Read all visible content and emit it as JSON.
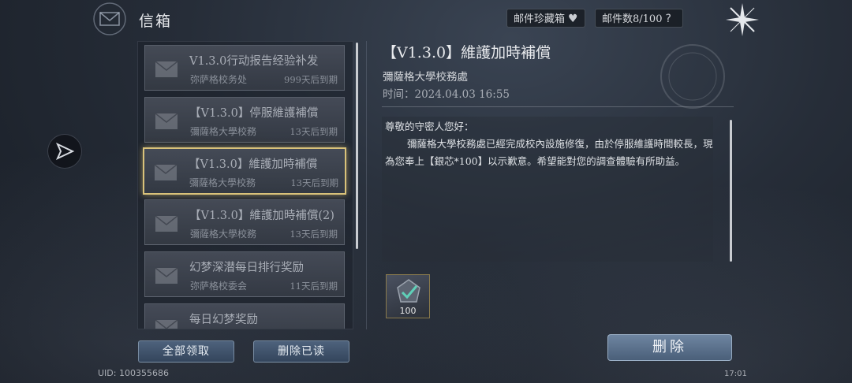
{
  "header": {
    "title": "信箱",
    "collection_label": "邮件珍藏箱",
    "mail_count_label": "邮件数8/100",
    "help_label": "?"
  },
  "mail_list": [
    {
      "subject": "V1.3.0行动报告经验补发",
      "sender": "弥萨格校务处",
      "expiry": "999天后到期"
    },
    {
      "subject": "【V1.3.0】停服維護補償",
      "sender": "彌薩格大學校務",
      "expiry": "13天后到期"
    },
    {
      "subject": "【V1.3.0】維護加時補償",
      "sender": "彌薩格大學校務",
      "expiry": "13天后到期",
      "selected": true
    },
    {
      "subject": "【V1.3.0】維護加時補償(2)",
      "sender": "彌薩格大學校務",
      "expiry": "13天后到期"
    },
    {
      "subject": "幻梦深潜每日排行奖励",
      "sender": "弥萨格校委会",
      "expiry": "11天后到期"
    },
    {
      "subject": "每日幻梦奖励",
      "sender": "",
      "expiry": ""
    }
  ],
  "actions": {
    "claim_all": "全部领取",
    "delete_read": "删除已读",
    "delete": "删除"
  },
  "detail": {
    "title": "【V1.3.0】維護加時補償",
    "sender": "彌薩格大學校務處",
    "time": "时间：2024.04.03 16:55",
    "greeting": "尊敬的守密人您好：",
    "body": "彌薩格大學校務處已經完成校內設施修復，由於停服維護時間較長，現為您奉上【銀芯*100】以示歉意。希望能對您的調查體驗有所助益。",
    "reward_count": "100"
  },
  "footer": {
    "uid": "UID: 100355686",
    "clock": "17:01"
  },
  "icons": {
    "crest": "mail-crest-icon",
    "heart": "heart-icon",
    "compass": "compass-close-icon",
    "send": "send-icon",
    "envelope": "envelope-icon",
    "reward": "silver-core-icon"
  },
  "colors": {
    "selected_border": "#d9c27a",
    "button": "#4e627c"
  }
}
